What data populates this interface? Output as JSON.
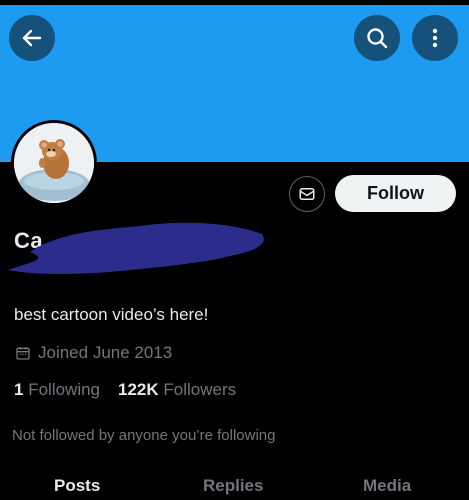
{
  "header": {
    "back_icon": "arrow-left-icon",
    "search_icon": "search-icon",
    "more_icon": "more-vertical-icon",
    "banner_color": "#1d9bf0"
  },
  "profile": {
    "name_visible": "Ca",
    "handle_visible": "",
    "bio": "best cartoon video’s here!",
    "joined": "Joined June 2013",
    "following_count": "1",
    "following_label": "Following",
    "followers_count": "122K",
    "followers_label": "Followers",
    "not_followed_text": "Not followed by anyone you’re following"
  },
  "actions": {
    "message_icon": "envelope-icon",
    "follow_label": "Follow"
  },
  "tabs": [
    {
      "label": "Posts",
      "active": true
    },
    {
      "label": "Replies",
      "active": false
    },
    {
      "label": "Media",
      "active": false
    }
  ]
}
